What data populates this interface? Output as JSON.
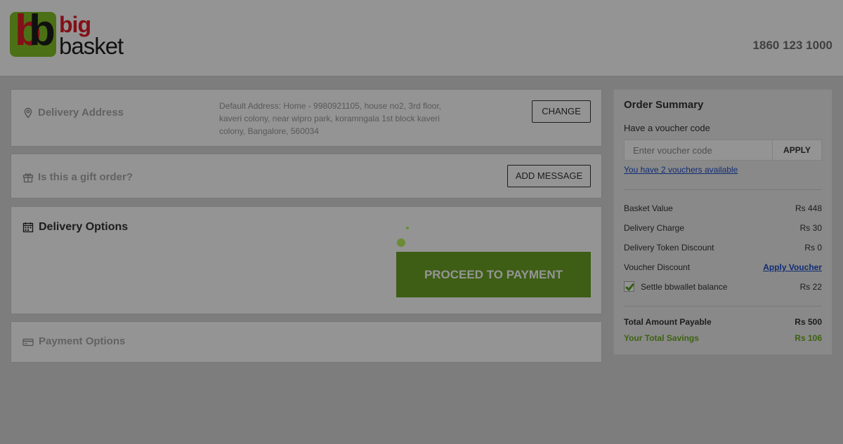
{
  "brand": {
    "name_line1": "big",
    "name_line2": "basket",
    "logo_letters": "bb",
    "colors": {
      "green": "#84c225",
      "red": "#e01d28",
      "dark": "#1d1d1d"
    }
  },
  "header": {
    "phone": "1860 123 1000"
  },
  "delivery_address": {
    "title": "Delivery Address",
    "icon": "map-pin-icon",
    "address": "Default Address: Home - 9980921105, house no2, 3rd floor, kaveri colony, near wipro park, koramngala 1st block kaveri colony, Bangalore, 560034",
    "change_label": "CHANGE"
  },
  "gift": {
    "title": "Is this a gift order?",
    "icon": "gift-icon",
    "button_label": "ADD MESSAGE"
  },
  "delivery_options": {
    "title": "Delivery Options",
    "icon": "calendar-icon",
    "proceed_label": "PROCEED TO PAYMENT",
    "accent": "#69a224"
  },
  "payment_options": {
    "title": "Payment Options",
    "icon": "credit-card-icon"
  },
  "order_summary": {
    "title": "Order Summary",
    "voucher_label": "Have a voucher code",
    "voucher_placeholder": "Enter voucher code",
    "apply_label": "APPLY",
    "vouchers_link": "You have 2 vouchers available",
    "rows": [
      {
        "label": "Basket Value",
        "value": "Rs 448"
      },
      {
        "label": "Delivery Charge",
        "value": "Rs 30"
      },
      {
        "label": "Delivery Token Discount",
        "value": "Rs 0"
      },
      {
        "label": "Voucher Discount",
        "value": "Apply Voucher"
      },
      {
        "label": "Settle bbwallet balance",
        "value": "Rs 22",
        "checked": true
      }
    ],
    "total_label": "Total Amount Payable",
    "total_value": "Rs 500",
    "savings_label": "Your Total Savings",
    "savings_value": "Rs 106"
  }
}
